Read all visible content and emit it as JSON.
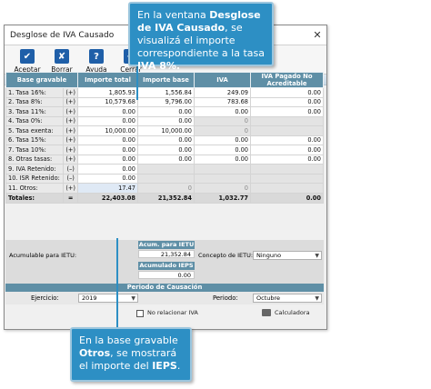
{
  "window": {
    "title": "Desglose de IVA Causado",
    "close": "✕"
  },
  "toolbar": [
    {
      "label": "Aceptar",
      "icon": "check-icon",
      "glyph": "✔",
      "color": "#1f5fa8"
    },
    {
      "label": "Borrar",
      "icon": "erase-icon",
      "glyph": "✘",
      "color": "#1f5fa8"
    },
    {
      "label": "Ayuda",
      "icon": "help-icon",
      "glyph": "?",
      "color": "#1f5fa8"
    },
    {
      "label": "Cerrar",
      "icon": "exit-icon",
      "glyph": "⇥",
      "color": "#1f5fa8"
    }
  ],
  "table": {
    "headers": [
      "Base gravable",
      "Importe total",
      "Importe base",
      "IVA",
      "IVA Pagado No Acreditable"
    ],
    "rows": [
      {
        "label": "1. Tasa 16%:",
        "sign": "(+)",
        "total": "1,805.93",
        "base": "1,556.84",
        "iva": "249.09",
        "ivana": "0.00"
      },
      {
        "label": "2. Tasa 8%:",
        "sign": "(+)",
        "total": "10,579.68",
        "base": "9,796.00",
        "iva": "783.68",
        "ivana": "0.00"
      },
      {
        "label": "3. Tasa 11%:",
        "sign": "(+)",
        "total": "0.00",
        "base": "0.00",
        "iva": "0.00",
        "ivana": "0.00"
      },
      {
        "label": "4. Tasa 0%:",
        "sign": "(+)",
        "total": "0.00",
        "base": "0.00",
        "iva": "0",
        "ivana": ""
      },
      {
        "label": "5. Tasa exenta:",
        "sign": "(+)",
        "total": "10,000.00",
        "base": "10,000.00",
        "iva": "0",
        "ivana": ""
      },
      {
        "label": "6. Tasa 15%:",
        "sign": "(+)",
        "total": "0.00",
        "base": "0.00",
        "iva": "0.00",
        "ivana": "0.00"
      },
      {
        "label": "7. Tasa 10%:",
        "sign": "(+)",
        "total": "0.00",
        "base": "0.00",
        "iva": "0.00",
        "ivana": "0.00"
      },
      {
        "label": "8. Otras tasas:",
        "sign": "(+)",
        "total": "0.00",
        "base": "0.00",
        "iva": "0.00",
        "ivana": "0.00"
      },
      {
        "label": "9. IVA Retenido:",
        "sign": "(–)",
        "total": "0.00",
        "base": "",
        "iva": "",
        "ivana": ""
      },
      {
        "label": "10. ISR Retenido:",
        "sign": "(–)",
        "total": "0.00",
        "base": "",
        "iva": "",
        "ivana": ""
      },
      {
        "label": "11. Otros:",
        "sign": "(+)",
        "total": "17.47",
        "base": "0",
        "iva": "0",
        "ivana": ""
      }
    ],
    "totals": {
      "label": "Totales:",
      "sign": "=",
      "total": "22,403.08",
      "base": "21,352.84",
      "iva": "1,032.77",
      "ivana": "0.00"
    }
  },
  "ietu": {
    "acum_header": "Acum. para IETU",
    "acum_label": "Acumulable para IETU:",
    "acum_value": "21,352.84",
    "concepto_label": "Concepto de IETU:",
    "concepto_value": "Ninguno",
    "ieps_header": "Acumulado IEPS",
    "ieps_value": "0.00"
  },
  "periodo": {
    "header": "Periodo de Causación",
    "ejercicio_label": "Ejercicio:",
    "ejercicio_value": "2019",
    "periodo_label": "Periodo:",
    "periodo_value": "Octubre"
  },
  "status": {
    "checkbox_label": "No relacionar IVA",
    "calc_label": "Calculadora"
  },
  "callouts": {
    "top": {
      "p1": "En la ventana ",
      "b1": "Desglose de IVA Causado",
      "p2": ", se visualizá el importe correspondiente a la tasa ",
      "b2": "IVA 8%."
    },
    "bottom": {
      "p1": "En la base gravable ",
      "b1": "Otros",
      "p2": ", se mostrará el importe del ",
      "b2": "IEPS",
      "p3": "."
    }
  }
}
